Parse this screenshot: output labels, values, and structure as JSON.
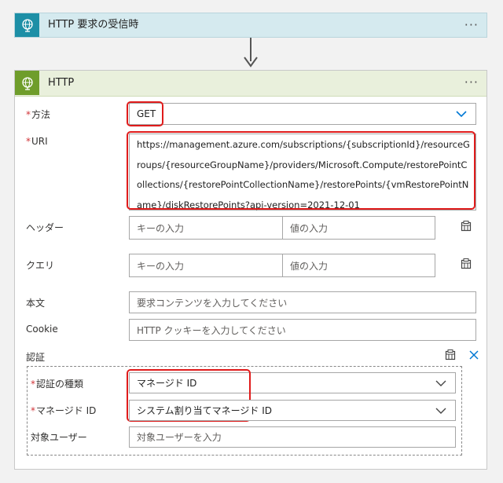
{
  "trigger": {
    "title": "HTTP 要求の受信時",
    "menu": "···",
    "icon": "globe-icon"
  },
  "action": {
    "title": "HTTP",
    "menu": "···",
    "icon": "globe-icon"
  },
  "fields": {
    "method": {
      "label": "方法",
      "required": "*",
      "value": "GET"
    },
    "uri": {
      "label": "URI",
      "required": "*",
      "value": "https://management.azure.com/subscriptions/{subscriptionId}/resourceGroups/{resourceGroupName}/providers/Microsoft.Compute/restorePointCollections/{restorePointCollectionName}/restorePoints/{vmRestorePointName}/diskRestorePoints?api-version=2021-12-01"
    },
    "headers": {
      "label": "ヘッダー",
      "key_placeholder": "キーの入力",
      "value_placeholder": "値の入力"
    },
    "queries": {
      "label": "クエリ",
      "key_placeholder": "キーの入力",
      "value_placeholder": "値の入力"
    },
    "body": {
      "label": "本文",
      "placeholder": "要求コンテンツを入力してください"
    },
    "cookie": {
      "label": "Cookie",
      "placeholder": "HTTP クッキーを入力してください"
    }
  },
  "auth": {
    "label": "認証",
    "type": {
      "label": "認証の種類",
      "required": "*",
      "value": "マネージド ID"
    },
    "managed_identity": {
      "label": "マネージド ID",
      "required": "*",
      "value": "システム割り当てマネージド ID"
    },
    "audience": {
      "label": "対象ユーザー",
      "placeholder": "対象ユーザーを入力"
    }
  },
  "colors": {
    "highlight": "#e01b1b",
    "trigger_icon_bg": "#1d8fa6",
    "action_icon_bg": "#6f9d2b",
    "chevron": "#0078d4"
  }
}
